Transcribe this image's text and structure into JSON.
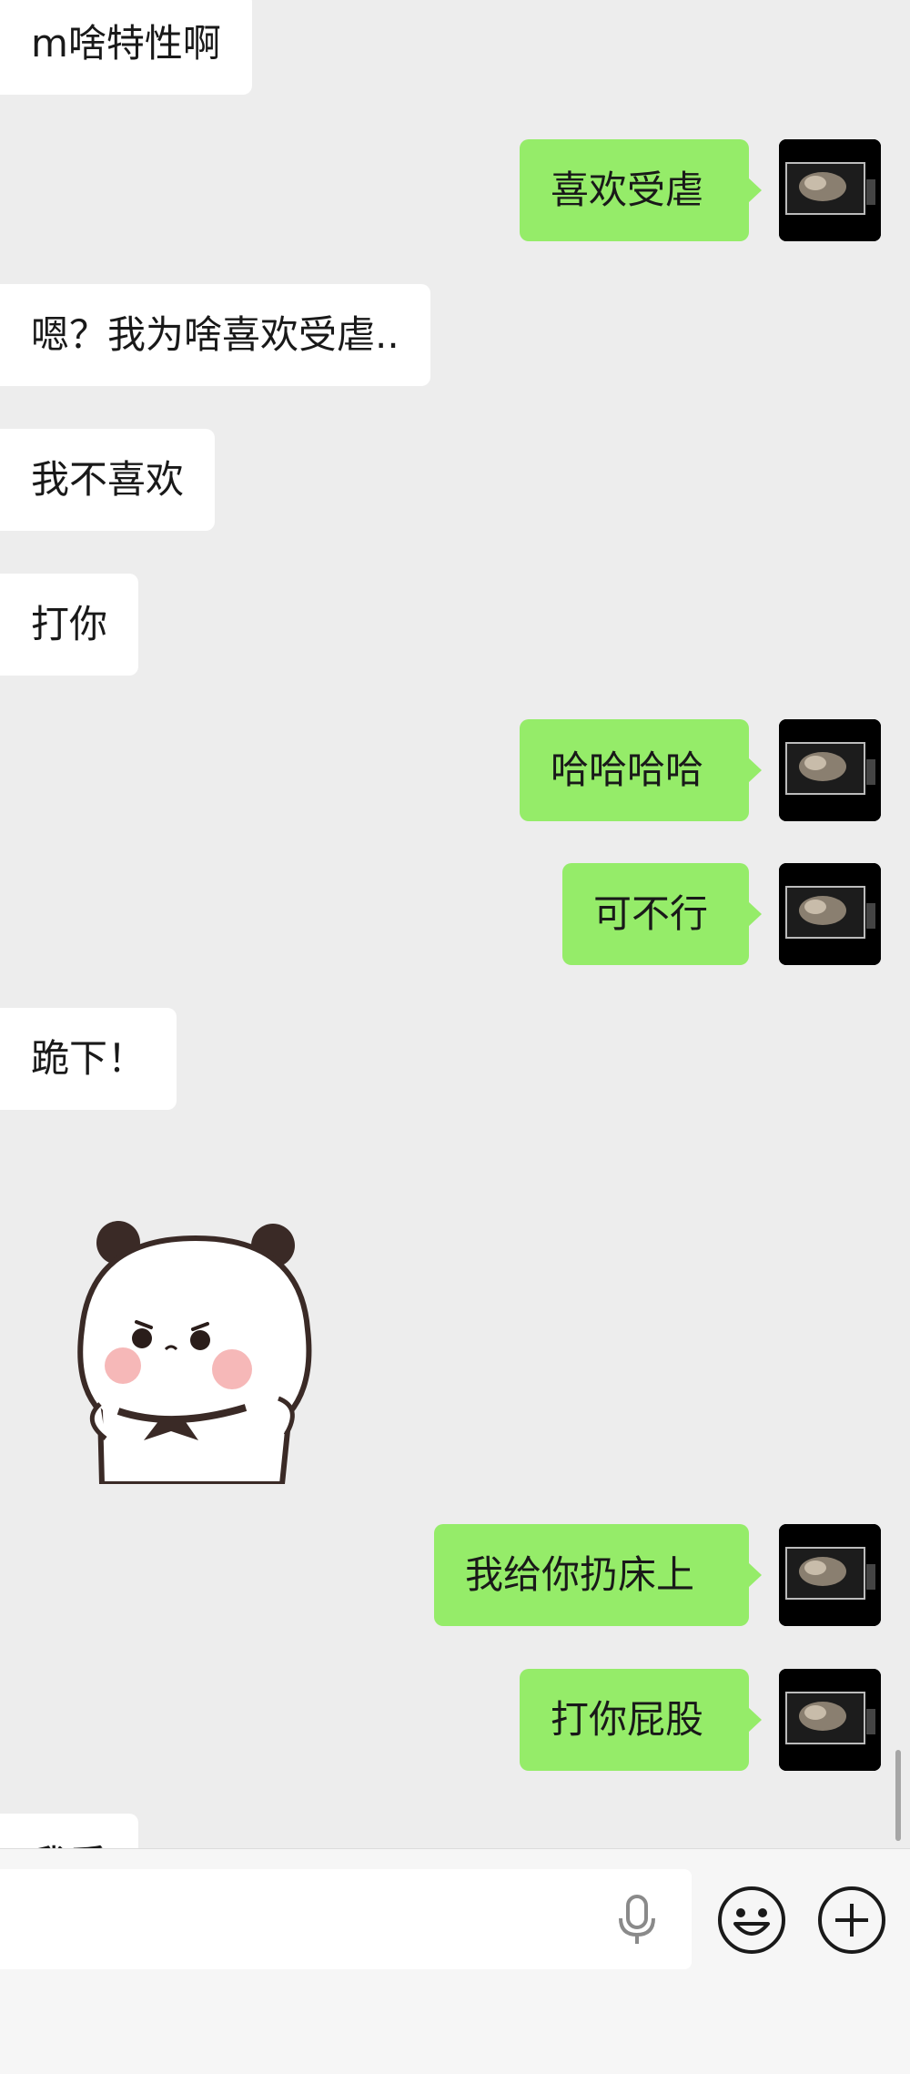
{
  "colors": {
    "background": "#ededed",
    "incoming_bubble": "#ffffff",
    "outgoing_bubble": "#95ec69",
    "text": "#191919"
  },
  "messages": [
    {
      "side": "incoming",
      "text": "m啥特性啊"
    },
    {
      "side": "outgoing",
      "text": "喜欢受虐"
    },
    {
      "side": "incoming",
      "text": "嗯？我为啥喜欢受虐.."
    },
    {
      "side": "incoming",
      "text": "我不喜欢"
    },
    {
      "side": "incoming",
      "text": "打你"
    },
    {
      "side": "outgoing",
      "text": "哈哈哈哈"
    },
    {
      "side": "outgoing",
      "text": "可不行"
    },
    {
      "side": "incoming",
      "text": "跪下！"
    },
    {
      "side": "incoming",
      "type": "sticker",
      "sticker": "panda-bear-sticker"
    },
    {
      "side": "outgoing",
      "text": "我给你扔床上"
    },
    {
      "side": "outgoing",
      "text": "打你屁股"
    },
    {
      "side": "incoming",
      "text": "我丢"
    }
  ],
  "input_bar": {
    "icons": [
      "microphone-icon",
      "emoji-icon",
      "plus-icon"
    ]
  }
}
